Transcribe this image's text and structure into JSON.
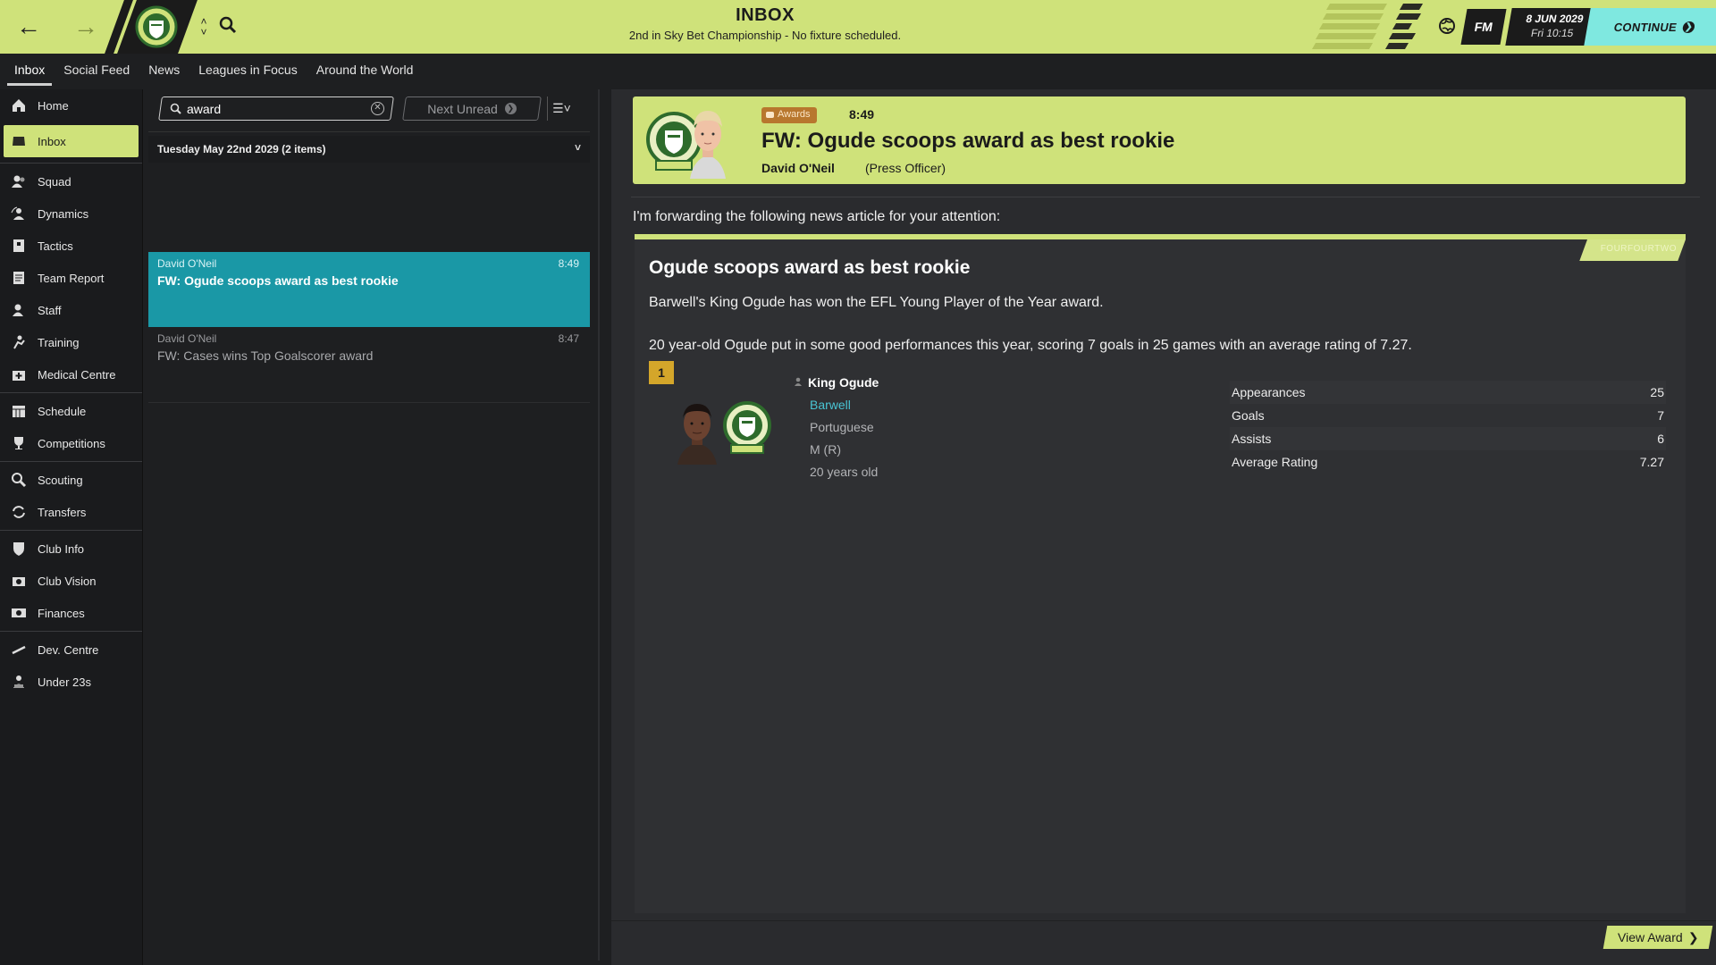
{
  "topbar": {
    "title": "INBOX",
    "subtitle": "2nd in Sky Bet Championship - No fixture scheduled.",
    "fm_label": "FM",
    "date": "8 JUN 2029",
    "day_time": "Fri 10:15",
    "continue_label": "CONTINUE",
    "colors": {
      "accent": "#cfe27a",
      "continue": "#7fe8e0"
    }
  },
  "tabs": [
    "Inbox",
    "Social Feed",
    "News",
    "Leagues in Focus",
    "Around the World"
  ],
  "sidebar": {
    "items": [
      {
        "label": "Home",
        "icon": "home-icon"
      },
      {
        "label": "Inbox",
        "icon": "inbox-icon",
        "active": true
      },
      {
        "label": "Squad",
        "icon": "squad-icon"
      },
      {
        "label": "Dynamics",
        "icon": "dynamics-icon"
      },
      {
        "label": "Tactics",
        "icon": "tactics-icon"
      },
      {
        "label": "Team Report",
        "icon": "report-icon"
      },
      {
        "label": "Staff",
        "icon": "staff-icon"
      },
      {
        "label": "Training",
        "icon": "training-icon"
      },
      {
        "label": "Medical Centre",
        "icon": "medical-icon"
      },
      {
        "label": "Schedule",
        "icon": "schedule-icon"
      },
      {
        "label": "Competitions",
        "icon": "trophy-icon"
      },
      {
        "label": "Scouting",
        "icon": "scouting-icon"
      },
      {
        "label": "Transfers",
        "icon": "transfers-icon"
      },
      {
        "label": "Club Info",
        "icon": "shield-icon"
      },
      {
        "label": "Club Vision",
        "icon": "vision-icon"
      },
      {
        "label": "Finances",
        "icon": "finances-icon"
      },
      {
        "label": "Dev. Centre",
        "icon": "dev-centre-icon"
      },
      {
        "label": "Under 23s",
        "icon": "under23-icon"
      }
    ]
  },
  "inbox": {
    "search_value": "award",
    "next_unread_label": "Next Unread",
    "group_header": "Tuesday May 22nd 2029 (2 items)",
    "messages": [
      {
        "sender": "David O'Neil",
        "time": "8:49",
        "subject": "FW: Ogude scoops award as best rookie",
        "selected": true
      },
      {
        "sender": "David O'Neil",
        "time": "8:47",
        "subject": "FW: Cases wins Top Goalscorer award",
        "selected": false
      }
    ]
  },
  "detail": {
    "tag": "Awards",
    "time": "8:49",
    "subject": "FW: Ogude scoops award as best rookie",
    "sender": "David O'Neil",
    "role": "(Press Officer)",
    "intro": "I'm forwarding the following news article for your attention:",
    "article": {
      "source": "FOURFOURTWO",
      "title": "Ogude scoops award as best rookie",
      "p1": "Barwell's King Ogude has won the EFL Young Player of the Year award.",
      "p2": "20 year-old Ogude put in some good performances this year, scoring 7 goals in 25 games with an average rating of 7.27.",
      "rank": "1",
      "player": {
        "name": "King Ogude",
        "club": "Barwell",
        "nationality": "Portuguese",
        "position": "M (R)",
        "age": "20 years old"
      },
      "stats": [
        {
          "label": "Appearances",
          "value": "25"
        },
        {
          "label": "Goals",
          "value": "7"
        },
        {
          "label": "Assists",
          "value": "6"
        },
        {
          "label": "Average Rating",
          "value": "7.27"
        }
      ]
    },
    "view_award_label": "View Award"
  }
}
